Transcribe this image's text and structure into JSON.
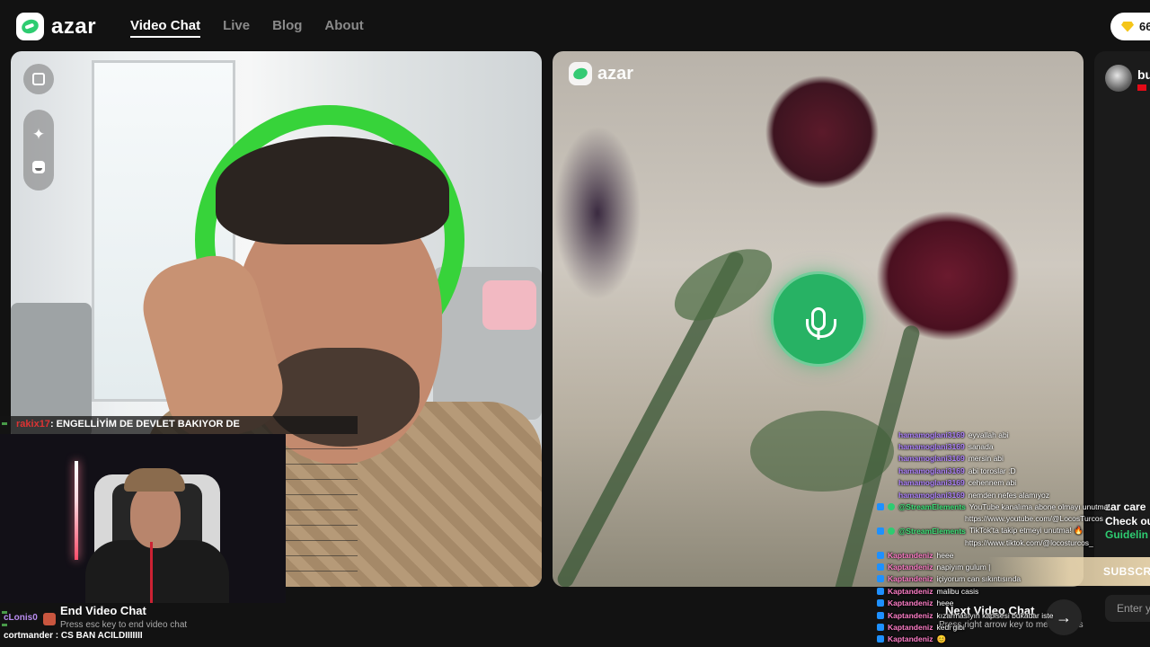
{
  "header": {
    "logo_text": "azar",
    "nav": [
      "Video Chat",
      "Live",
      "Blog",
      "About"
    ],
    "active_nav": "Video Chat",
    "gem_count": "66"
  },
  "left_panel": {
    "tools": [
      "expand-icon",
      "sparkle-effects-icon",
      "emoji-face-icon"
    ]
  },
  "right_panel": {
    "watermark": "azar",
    "mic_button": "microphone-icon"
  },
  "third_panel": {
    "name": "bu",
    "care_text": "zar care",
    "check_text": "Check ou",
    "guideline_text": "Guidelin",
    "subscribe_text": "SUBSCR",
    "input_placeholder": "Enter y"
  },
  "controls": {
    "end_label": "End Video Chat",
    "end_hint": "Press esc key to end video chat",
    "next_label": "Next Video Chat",
    "next_hint": "Press right arrow key to meet others"
  },
  "stream_overlay": {
    "top_user": "rakix17",
    "top_message": ": ENGELLİYİM DE DEVLET BAKIYOR DE",
    "bottom_lines": [
      {
        "user": "cLonis0",
        "message": ""
      },
      {
        "user": "cortmander",
        "message": " : CS BAN ACILDIIIIIII"
      }
    ]
  },
  "chat": [
    {
      "user": "hamamoglani3169",
      "message": "eyvallah abi",
      "color": "purple",
      "badge": false
    },
    {
      "user": "hamamoglani3169",
      "message": "sanada",
      "color": "purple",
      "badge": false
    },
    {
      "user": "hamamoglani3169",
      "message": "mersin abi",
      "color": "purple",
      "badge": false
    },
    {
      "user": "hamamoglani3169",
      "message": "abi toroslar :D",
      "color": "purple",
      "badge": false
    },
    {
      "user": "hamamoglani3169",
      "message": "cehennem abi",
      "color": "purple",
      "badge": false
    },
    {
      "user": "hamamoglani3169",
      "message": "nemden nefes alamıyoz",
      "color": "purple",
      "badge": false
    },
    {
      "user": "@StreamElements",
      "message": "YouTube kanalıma abone olmayı unutma!",
      "color": "green",
      "badge": true
    },
    {
      "user": "",
      "message": "https://www.youtube.com/@LocosTurcos",
      "color": "green",
      "badge": false,
      "sub": true
    },
    {
      "user": "@StreamElements",
      "message": "TikTok'ta takip etmeyi unutma! 🔥",
      "color": "green",
      "badge": true
    },
    {
      "user": "",
      "message": "https://www.tiktok.com/@locosturcos_",
      "color": "green",
      "badge": false,
      "sub": true
    },
    {
      "user": "Kaptandeniz",
      "message": "heee",
      "color": "pink",
      "badge": true
    },
    {
      "user": "Kaptandeniz",
      "message": "napiyım gulum |",
      "color": "pink",
      "badge": true
    },
    {
      "user": "Kaptandeniz",
      "message": "içiyorum can sıkıntısında",
      "color": "pink",
      "badge": true
    },
    {
      "user": "Kaptandeniz",
      "message": "malibu casis",
      "color": "pink",
      "badge": true
    },
    {
      "user": "Kaptandeniz",
      "message": "heee",
      "color": "pink",
      "badge": true
    },
    {
      "user": "Kaptandeniz",
      "message": "kızarmasıyın kapisesi bukadar iste",
      "color": "pink",
      "badge": true
    },
    {
      "user": "Kaptandeniz",
      "message": "kedi gibi",
      "color": "pink",
      "badge": true
    },
    {
      "user": "Kaptandeniz",
      "message": "😊",
      "color": "pink",
      "badge": true
    }
  ]
}
